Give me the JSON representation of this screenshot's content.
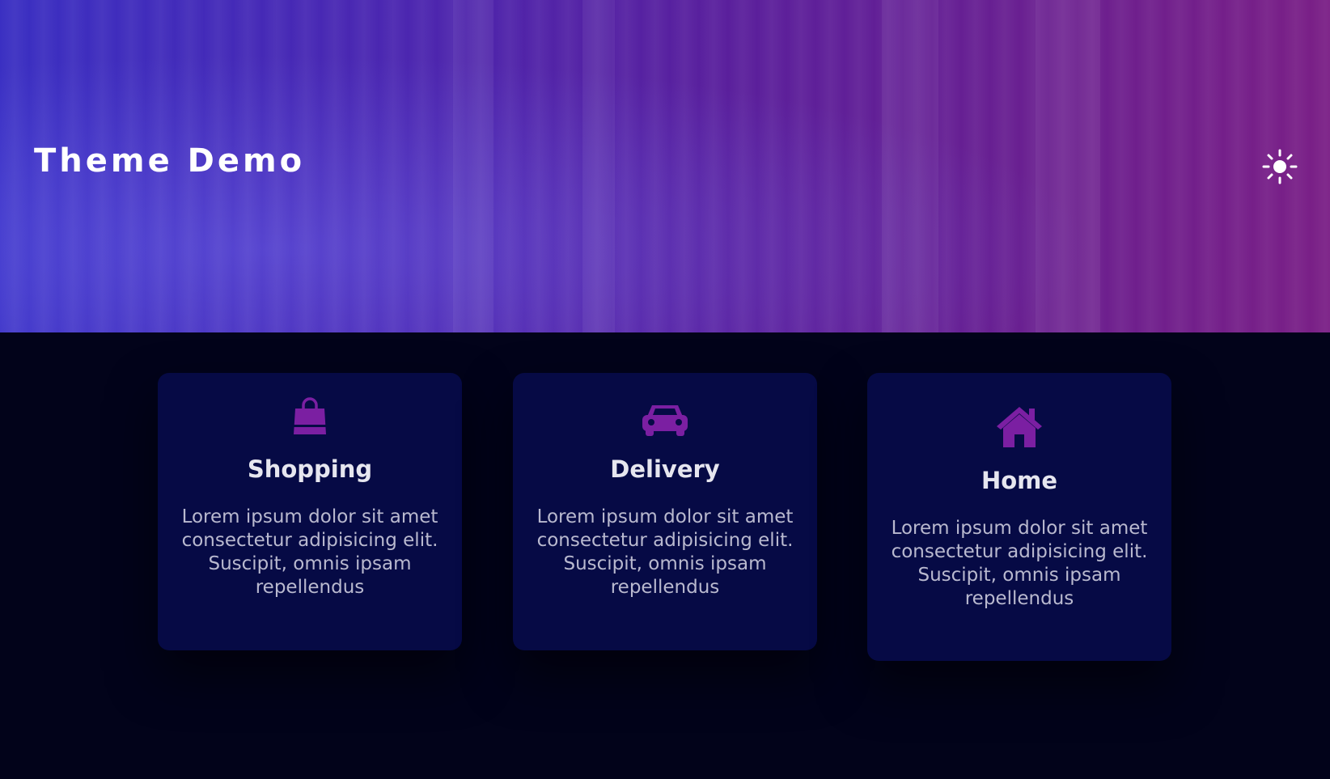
{
  "header": {
    "title": "Theme Demo",
    "theme_toggle_icon": "sun-icon"
  },
  "cards": [
    {
      "icon": "shopping-bag-icon",
      "title": "Shopping",
      "text": "Lorem ipsum dolor sit amet consectetur adipisicing elit. Suscipit, omnis ipsam repellendus"
    },
    {
      "icon": "car-icon",
      "title": "Delivery",
      "text": "Lorem ipsum dolor sit amet consectetur adipisicing elit. Suscipit, omnis ipsam repellendus"
    },
    {
      "icon": "home-icon",
      "title": "Home",
      "text": "Lorem ipsum dolor sit amet consectetur adipisicing elit. Suscipit, omnis ipsam repellendus"
    }
  ],
  "colors": {
    "accent": "#7b1fa2",
    "background": "#02031a",
    "card": "#060a45"
  }
}
